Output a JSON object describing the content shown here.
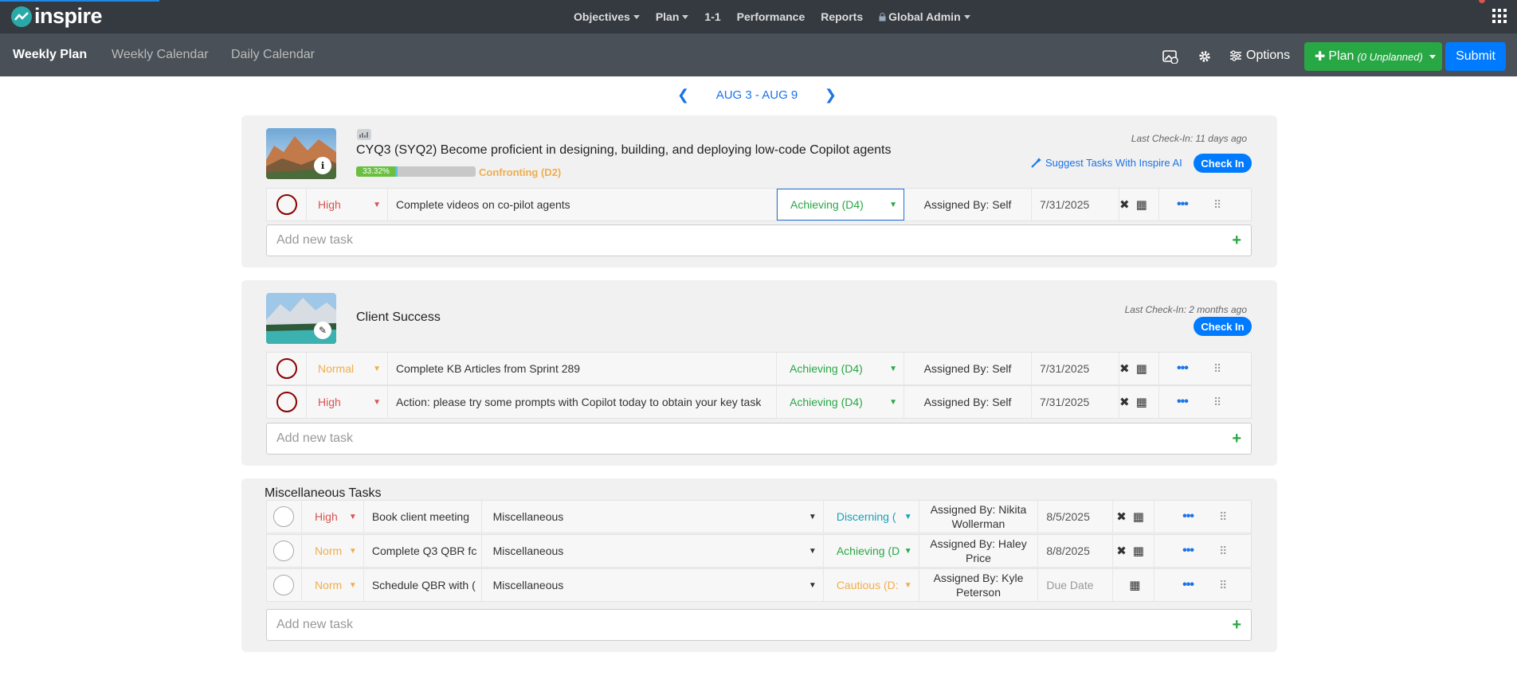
{
  "app": {
    "logo_text": "inspire"
  },
  "menu": [
    {
      "label": "Objectives",
      "dropdown": true
    },
    {
      "label": "Plan",
      "dropdown": true
    },
    {
      "label": "1-1",
      "dropdown": false
    },
    {
      "label": "Performance",
      "dropdown": false
    },
    {
      "label": "Reports",
      "dropdown": false
    },
    {
      "label": "Global Admin",
      "dropdown": true
    }
  ],
  "subnav": {
    "tabs": [
      "Weekly Plan",
      "Weekly Calendar",
      "Daily Calendar"
    ],
    "options_label": "Options",
    "plan_label": "Plan",
    "plan_count": "(0 Unplanned)",
    "submit_label": "Submit"
  },
  "week": {
    "range": "AUG 3 - AUG 9"
  },
  "objectives": [
    {
      "title": "CYQ3 (SYQ2) Become proficient in designing, building, and deploying low-code Copilot agents",
      "progress_label": "33.32%",
      "progress": 0.3332,
      "status": "Confronting (D2)",
      "last_checkin": "Last Check-In: 11 days ago",
      "suggest": "Suggest Tasks With Inspire AI",
      "checkin": "Check In",
      "tasks": [
        {
          "priority": "High",
          "name": "Complete videos on co-pilot agents",
          "status": "Achieving (D4)",
          "assigned": "Assigned By: Self",
          "date": "7/31/2025"
        }
      ],
      "add_placeholder": "Add new task"
    },
    {
      "title": "Client Success",
      "last_checkin": "Last Check-In: 2 months ago",
      "checkin": "Check In",
      "tasks": [
        {
          "priority": "Normal",
          "name": "Complete KB Articles from Sprint 289",
          "status": "Achieving (D4)",
          "assigned": "Assigned By: Self",
          "date": "7/31/2025"
        },
        {
          "priority": "High",
          "name": "Action: please try some prompts with Copilot today to obtain your key task",
          "status": "Achieving (D4)",
          "assigned": "Assigned By: Self",
          "date": "7/31/2025"
        }
      ],
      "add_placeholder": "Add new task"
    }
  ],
  "misc": {
    "title": "Miscellaneous Tasks",
    "tasks": [
      {
        "priority": "High",
        "name": "Book client meeting",
        "category": "Miscellaneous",
        "status": "Discerning (",
        "assigned": "Assigned By: Nikita Wollerman",
        "date": "8/5/2025"
      },
      {
        "priority": "Norm",
        "name": "Complete Q3 QBR fc",
        "category": "Miscellaneous",
        "status": "Achieving (D",
        "assigned": "Assigned By: Haley Price",
        "date": "8/8/2025"
      },
      {
        "priority": "Norm",
        "name": "Schedule QBR with (",
        "category": "Miscellaneous",
        "status": "Cautious (D:",
        "assigned": "Assigned By: Kyle Peterson",
        "date": "Due Date"
      }
    ],
    "add_placeholder": "Add new task"
  },
  "colors": {
    "primary": "#007bff",
    "success": "#28a745",
    "nav": "#343a40",
    "subnav": "#495057"
  }
}
